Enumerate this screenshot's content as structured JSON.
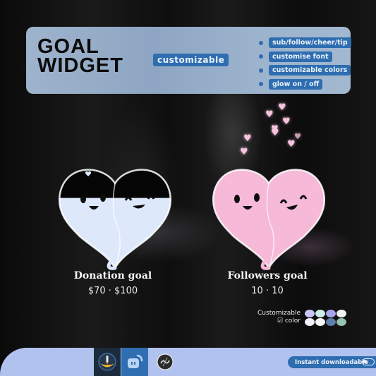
{
  "header": {
    "title_line1": "GOAL",
    "title_line2": "WIDGET",
    "main_tag": "customizable",
    "features": [
      "sub/follow/cheer/tip",
      "customise font",
      "customizable colors",
      "glow on / off"
    ]
  },
  "widgets": [
    {
      "id": "donation",
      "label": "Donation goal",
      "value": "$70 · $100",
      "progress_fraction": 0.7,
      "fill_color": "#dde9fb",
      "empty_color": "#050505"
    },
    {
      "id": "followers",
      "label": "Followers goal",
      "value": "10 · 10",
      "progress_fraction": 1.0,
      "fill_color": "#f6b9d8",
      "empty_color": "#050505"
    }
  ],
  "customization": {
    "label_line1": "Customizable",
    "label_line2": "color",
    "check_icon": "checkbox-icon",
    "swatches": [
      {
        "top": "#c9c6f4",
        "bottom": "#f1f1fb"
      },
      {
        "top": "#cbeee6",
        "bottom": "#f4f7f6"
      },
      {
        "top": "#a6a5ec",
        "bottom": "#5f7ea8"
      },
      {
        "top": "#eef3f1",
        "bottom": "#95c3b0"
      }
    ]
  },
  "bottom_bar": {
    "icons": [
      "streamlabs-rocket-icon",
      "streamelements-icon",
      "obs-icon"
    ],
    "instant_download_label": "Instant downloadable",
    "instant_download_toggle": "off"
  },
  "colors": {
    "accent_blue": "#2e6db0",
    "panel": "#9db2cb",
    "bottom_bar": "#b1c2ef",
    "heart_particle": "#f6c4de"
  }
}
